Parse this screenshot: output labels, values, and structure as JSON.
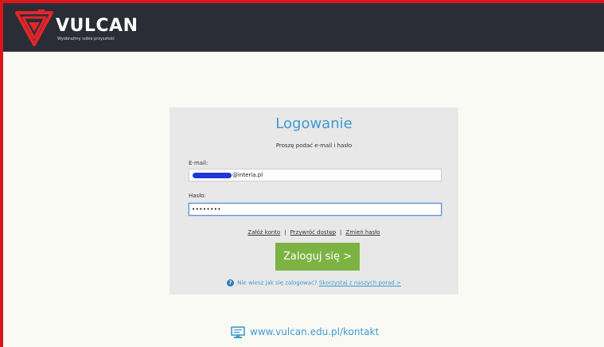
{
  "header": {
    "brand_name": "VULCAN",
    "tagline": "Wyobraźmy sobie przyszłość",
    "background": "#2b2d36"
  },
  "login": {
    "title": "Logowanie",
    "subtitle": "Proszę podać e-mail i hasło",
    "email_label": "E-mail:",
    "email_value_visible": "@interia.pl",
    "password_label": "Hasło:",
    "password_value": "••••••••",
    "links": {
      "create_account": "Załóż konto",
      "restore_access": "Przywróć dostęp",
      "change_password": "Zmień hasło",
      "separator": "|"
    },
    "submit_label": "Zaloguj się >",
    "help_text": "Nie wiesz jak się zalogować?",
    "help_link": "Skorzystaj z naszych porad >"
  },
  "footer": {
    "contact_url": "www.vulcan.edu.pl/kontakt"
  },
  "colors": {
    "accent_blue": "#3d9bd1",
    "button_green": "#7cb342",
    "frame_red": "#d9161b",
    "redaction_blue": "#1f36d9"
  },
  "icons": {
    "logo": "vulcan-logo-icon",
    "help": "question-circle-icon",
    "contact": "monitor-chat-icon"
  }
}
